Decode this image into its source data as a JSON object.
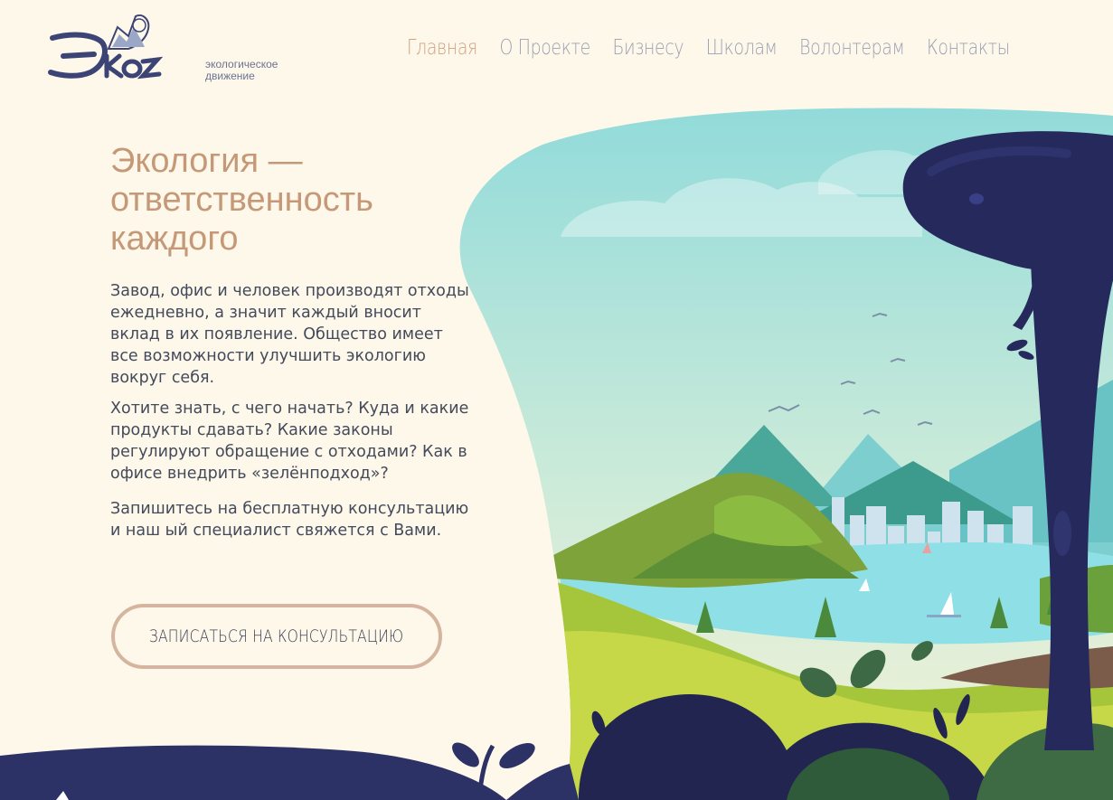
{
  "header": {
    "logo_text": "Эко",
    "logo_sub_line1": "экологическое",
    "logo_sub_line2": "движение"
  },
  "nav": {
    "items": [
      {
        "label": "Главная",
        "active": true
      },
      {
        "label": "О Проекте",
        "active": false
      },
      {
        "label": "Бизнесу",
        "active": false
      },
      {
        "label": "Школам",
        "active": false
      },
      {
        "label": "Волонтерам",
        "active": false
      },
      {
        "label": "Контакты",
        "active": false
      }
    ]
  },
  "hero": {
    "title_line1": "Экология —",
    "title_line2": "ответственность",
    "title_line3": "каждого",
    "paragraph1": "Завод, офис и человек производят отходы ежедневно, а значит каждый вносит вклад в их появление. Общество имеет все возможности улучшить экологию вокруг себя.",
    "paragraph2": "Хотите знать, с чего начать? Куда и какие продукты сдавать? Какие законы регулируют обращение с отходами? Как в офисе внедрить «зелёнподход»?",
    "paragraph3": "Запишитесь на бесплатную консультацию и наш ый специалист свяжется с Вами.",
    "cta_label": "ЗАПИСАТЬСЯ НА КОНСУЛЬТАЦИЮ"
  },
  "colors": {
    "background": "#fef8ea",
    "accent": "#c59978",
    "nav_text": "#9b9fb3",
    "navy": "#2b2f66"
  }
}
